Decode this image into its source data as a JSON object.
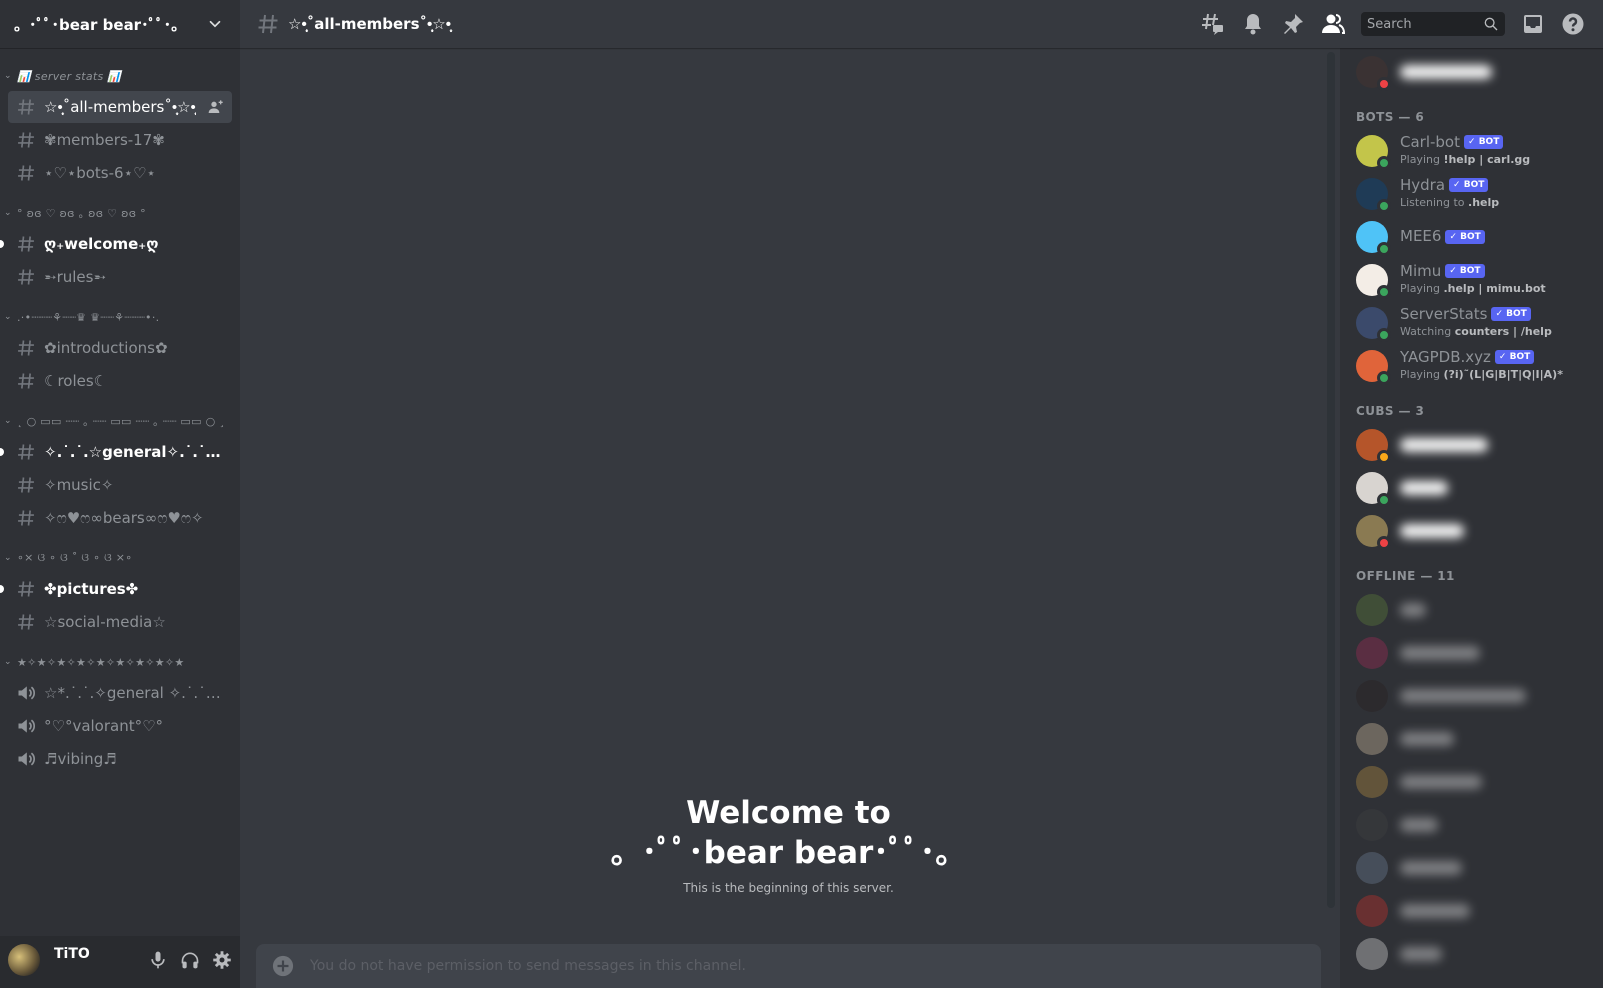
{
  "guild": {
    "name": "。･ﾟﾟ･bear bear･ﾟﾟ･。"
  },
  "sidebar": {
    "categories": [
      {
        "label": "📊 server stats 📊",
        "italic": true,
        "channels": [
          {
            "name": "☆•̩̩͙˚all-members˚•̩̩͙☆•̩̩͙",
            "type": "text",
            "selected": true,
            "unread": false
          },
          {
            "name": "✾members-17✾",
            "type": "text",
            "selected": false,
            "unread": false
          },
          {
            "name": "⋆♡⋆bots-6⋆♡⋆",
            "type": "text",
            "selected": false,
            "unread": false
          }
        ]
      },
      {
        "label": "° ʚɞ ♡ ʚɞ ｡ ʚɞ ♡ ʚɞ °",
        "italic": false,
        "channels": [
          {
            "name": "ღ₊welcome₊ღ",
            "type": "text",
            "selected": false,
            "unread": true
          },
          {
            "name": "➵rules➵",
            "type": "text",
            "selected": false,
            "unread": false
          }
        ]
      },
      {
        "label": ".·•┈┈┈⚘┈┈♛ ♛┈┈⚘┈┈┈•·.",
        "italic": false,
        "channels": [
          {
            "name": "✿introductions✿",
            "type": "text",
            "selected": false,
            "unread": false
          },
          {
            "name": "☾roles☾",
            "type": "text",
            "selected": false,
            "unread": false
          }
        ]
      },
      {
        "label": "˛ ○ ▭▭ ┈┈ ｡ ┈┈ ▭▭ ┈┈ ｡ ┈┈ ▭▭ ○ ¸",
        "italic": false,
        "channels": [
          {
            "name": "✧.˙.˙.☆general✧.˙.˙.☆",
            "type": "text",
            "selected": false,
            "unread": true
          },
          {
            "name": "✧music✧",
            "type": "text",
            "selected": false,
            "unread": false
          },
          {
            "name": "✧ෆ♥ෆ∞bears∞ෆ♥ෆ✧",
            "type": "text",
            "selected": false,
            "unread": false
          }
        ]
      },
      {
        "label": "∘× ଓ ∘ ଓ ˚ ଓ ∘ ଓ ×∘",
        "italic": false,
        "channels": [
          {
            "name": "✤pictures✤",
            "type": "text",
            "selected": false,
            "unread": true
          },
          {
            "name": "☆social-media☆",
            "type": "text",
            "selected": false,
            "unread": false
          }
        ]
      },
      {
        "label": "★✧★✧★✧★✧★✧★✧★✧★✧★",
        "italic": false,
        "channels": [
          {
            "name": "☆*.˙.˙.✧general ✧.˙.˙.*☆",
            "type": "voice",
            "selected": false,
            "unread": false
          },
          {
            "name": "°♡°valorant°♡°",
            "type": "voice",
            "selected": false,
            "unread": false
          },
          {
            "name": "♬vibing♬",
            "type": "voice",
            "selected": false,
            "unread": false
          }
        ]
      }
    ]
  },
  "user_panel": {
    "username": "TiTO"
  },
  "header": {
    "channel_name": "☆•̩̩͙˚all-members˚•̩̩͙☆•̩̩͙",
    "search_placeholder": "Search",
    "icons": [
      "threads-icon",
      "bell-icon",
      "pin-icon",
      "members-icon",
      "inbox-icon",
      "help-icon"
    ]
  },
  "chat": {
    "welcome_line1": "Welcome to",
    "welcome_line2": "。･ﾟﾟ･bear bear･ﾟﾟ･。",
    "welcome_sub": "This is the beginning of this server.",
    "composer_placeholder": "You do not have permission to send messages in this channel."
  },
  "members": {
    "groups": [
      {
        "label": "",
        "members": [
          {
            "name": "",
            "redacted": true,
            "status": "dnd",
            "offline": false,
            "avatar": "#3a3233"
          }
        ]
      },
      {
        "label": "BOTS — 6",
        "members": [
          {
            "name": "Carl-bot",
            "bot": true,
            "badge": "BOT",
            "activity_prefix": "Playing",
            "activity": "!help | carl.gg",
            "status": "online",
            "avatar": "#c3c54a"
          },
          {
            "name": "Hydra",
            "bot": true,
            "badge": "BOT",
            "activity_prefix": "Listening to",
            "activity": ".help",
            "status": "online",
            "avatar": "#1f3b56"
          },
          {
            "name": "MEE6",
            "bot": true,
            "badge": "BOT",
            "activity_prefix": "",
            "activity": "",
            "status": "online",
            "avatar": "#4fc3f7"
          },
          {
            "name": "Mimu",
            "bot": true,
            "badge": "BOT",
            "activity_prefix": "Playing",
            "activity": ".help | mimu.bot",
            "status": "online",
            "avatar": "#f3ede6"
          },
          {
            "name": "ServerStats",
            "bot": true,
            "badge": "BOT",
            "activity_prefix": "Watching",
            "activity": "counters | /help",
            "status": "online",
            "avatar": "#3b4a6b"
          },
          {
            "name": "YAGPDB.xyz",
            "bot": true,
            "badge": "BOT",
            "activity_prefix": "Playing",
            "activity": "(?i)˜(L|G|B|T|Q|I|A)*",
            "status": "online",
            "avatar": "#e0643a"
          }
        ]
      },
      {
        "label": "CUBS — 3",
        "members": [
          {
            "name": "",
            "redacted": true,
            "status": "idle",
            "offline": false,
            "avatar": "#b5552a"
          },
          {
            "name": "",
            "redacted": true,
            "status": "online",
            "offline": false,
            "avatar": "#d8d4d0"
          },
          {
            "name": "",
            "redacted": true,
            "status": "dnd",
            "offline": false,
            "avatar": "#8a7a52"
          }
        ]
      },
      {
        "label": "OFFLINE — 11",
        "members": [
          {
            "name": "",
            "redacted": true,
            "offline": true,
            "avatar": "#5a7a3a"
          },
          {
            "name": "",
            "redacted": true,
            "offline": true,
            "avatar": "#9a2a55"
          },
          {
            "name": "",
            "redacted": true,
            "offline": true,
            "avatar": "#2a2020"
          },
          {
            "name": "",
            "redacted": true,
            "offline": true,
            "avatar": "#c9b59a"
          },
          {
            "name": "",
            "redacted": true,
            "offline": true,
            "avatar": "#b08a40"
          },
          {
            "name": "",
            "redacted": true,
            "offline": true,
            "avatar": "#404040"
          },
          {
            "name": "",
            "redacted": true,
            "offline": true,
            "avatar": "#6a7a90"
          },
          {
            "name": "",
            "redacted": true,
            "offline": true,
            "avatar": "#c0302a"
          },
          {
            "name": "",
            "redacted": true,
            "offline": true,
            "avatar": "#cfcfcf"
          }
        ]
      }
    ]
  },
  "colors": {
    "brand_blurple": "#5865f2",
    "online": "#3ba55d",
    "dnd": "#ed4245",
    "idle": "#faa81a"
  }
}
